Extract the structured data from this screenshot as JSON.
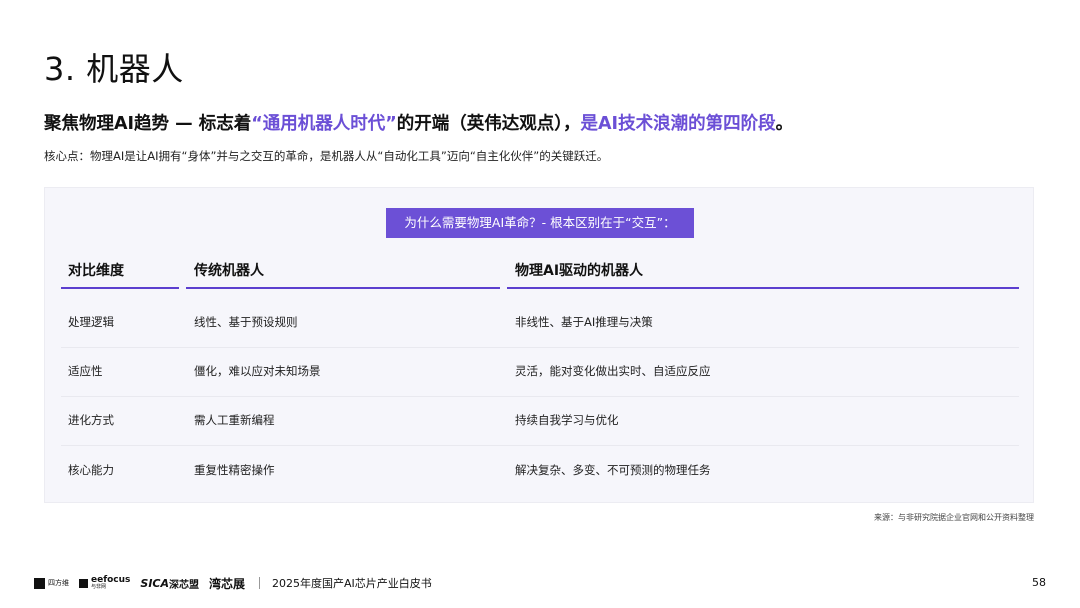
{
  "section_title": "3. 机器人",
  "subtitle": {
    "part1": "聚焦物理AI趋势 — 标志着",
    "part2": "“通用机器人时代”",
    "part3": "的开端（英伟达观点），",
    "part4": "是AI技术浪潮的第四阶段",
    "part5": "。"
  },
  "core_point": "核心点：物理AI是让AI拥有“身体”并与之交互的革命，是机器人从“自动化工具”迈向“自主化伙伴”的关键跃迁。",
  "panel_tag": "为什么需要物理AI革命？- 根本区别在于“交互”：",
  "table": {
    "headers": [
      "对比维度",
      "传统机器人",
      "物理AI驱动的机器人"
    ],
    "rows": [
      [
        "处理逻辑",
        "线性、基于预设规则",
        "非线性、基于AI推理与决策"
      ],
      [
        "适应性",
        "僵化，难以应对未知场景",
        "灵活，能对变化做出实时、自适应反应"
      ],
      [
        "进化方式",
        "需人工重新编程",
        "持续自我学习与优化"
      ],
      [
        "核心能力",
        "重复性精密操作",
        "解决复杂、多变、不可预测的物理任务"
      ]
    ]
  },
  "source": "来源：与非研究院据企业官网和公开资料整理",
  "footer": {
    "logos": {
      "logo1_name": "四方维",
      "logo2_name": "eefocus",
      "logo2_sub": "与非网",
      "logo3_name": "SICA",
      "logo3_sub": "深芯盟",
      "logo4_name": "湾芯展"
    },
    "doc_title": "2025年度国产AI芯片产业白皮书",
    "page_number": "58"
  },
  "colors": {
    "accent": "#6b4fd6",
    "tag_bg": "#6c50d6",
    "panel_bg": "#f6f6fb"
  }
}
